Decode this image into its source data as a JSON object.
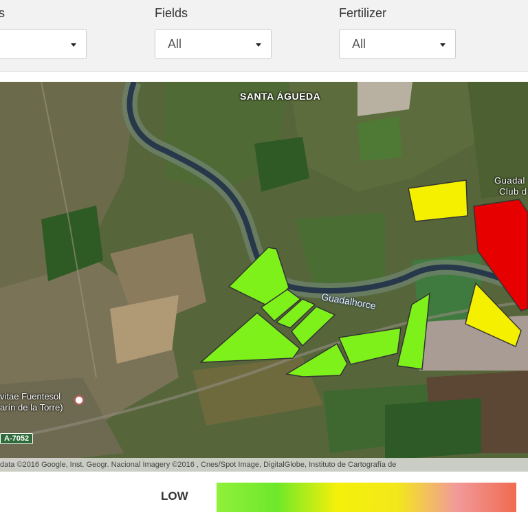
{
  "filters": [
    {
      "label": "s",
      "value": ""
    },
    {
      "label": "Fields",
      "value": "All"
    },
    {
      "label": "Fertilizer",
      "value": "All"
    }
  ],
  "map": {
    "place_labels": {
      "santa_agueda": "SANTA ÁGUEDA",
      "guadal_club_line1": "Guadal",
      "guadal_club_line2": "Club d"
    },
    "river_label": "Guadalhorce",
    "poi": {
      "line1": "vitae Fuentesol",
      "line2": "arín de la Torre)"
    },
    "road_shield": "A-7052",
    "attribution": "data ©2016 Google, Inst. Geogr. Nacional Imagery ©2016 , Cnes/Spot Image, DigitalGlobe, Instituto de Cartografía de",
    "field_colors": {
      "low": "#7ef01a",
      "medium": "#f4f000",
      "high": "#e60000"
    }
  },
  "legend": {
    "low_label": "LOW",
    "gradient_colors": [
      "#8ff03a",
      "#6ee82a",
      "#f4f00a",
      "#f3e81a",
      "#f29a9a",
      "#f06a50"
    ]
  }
}
